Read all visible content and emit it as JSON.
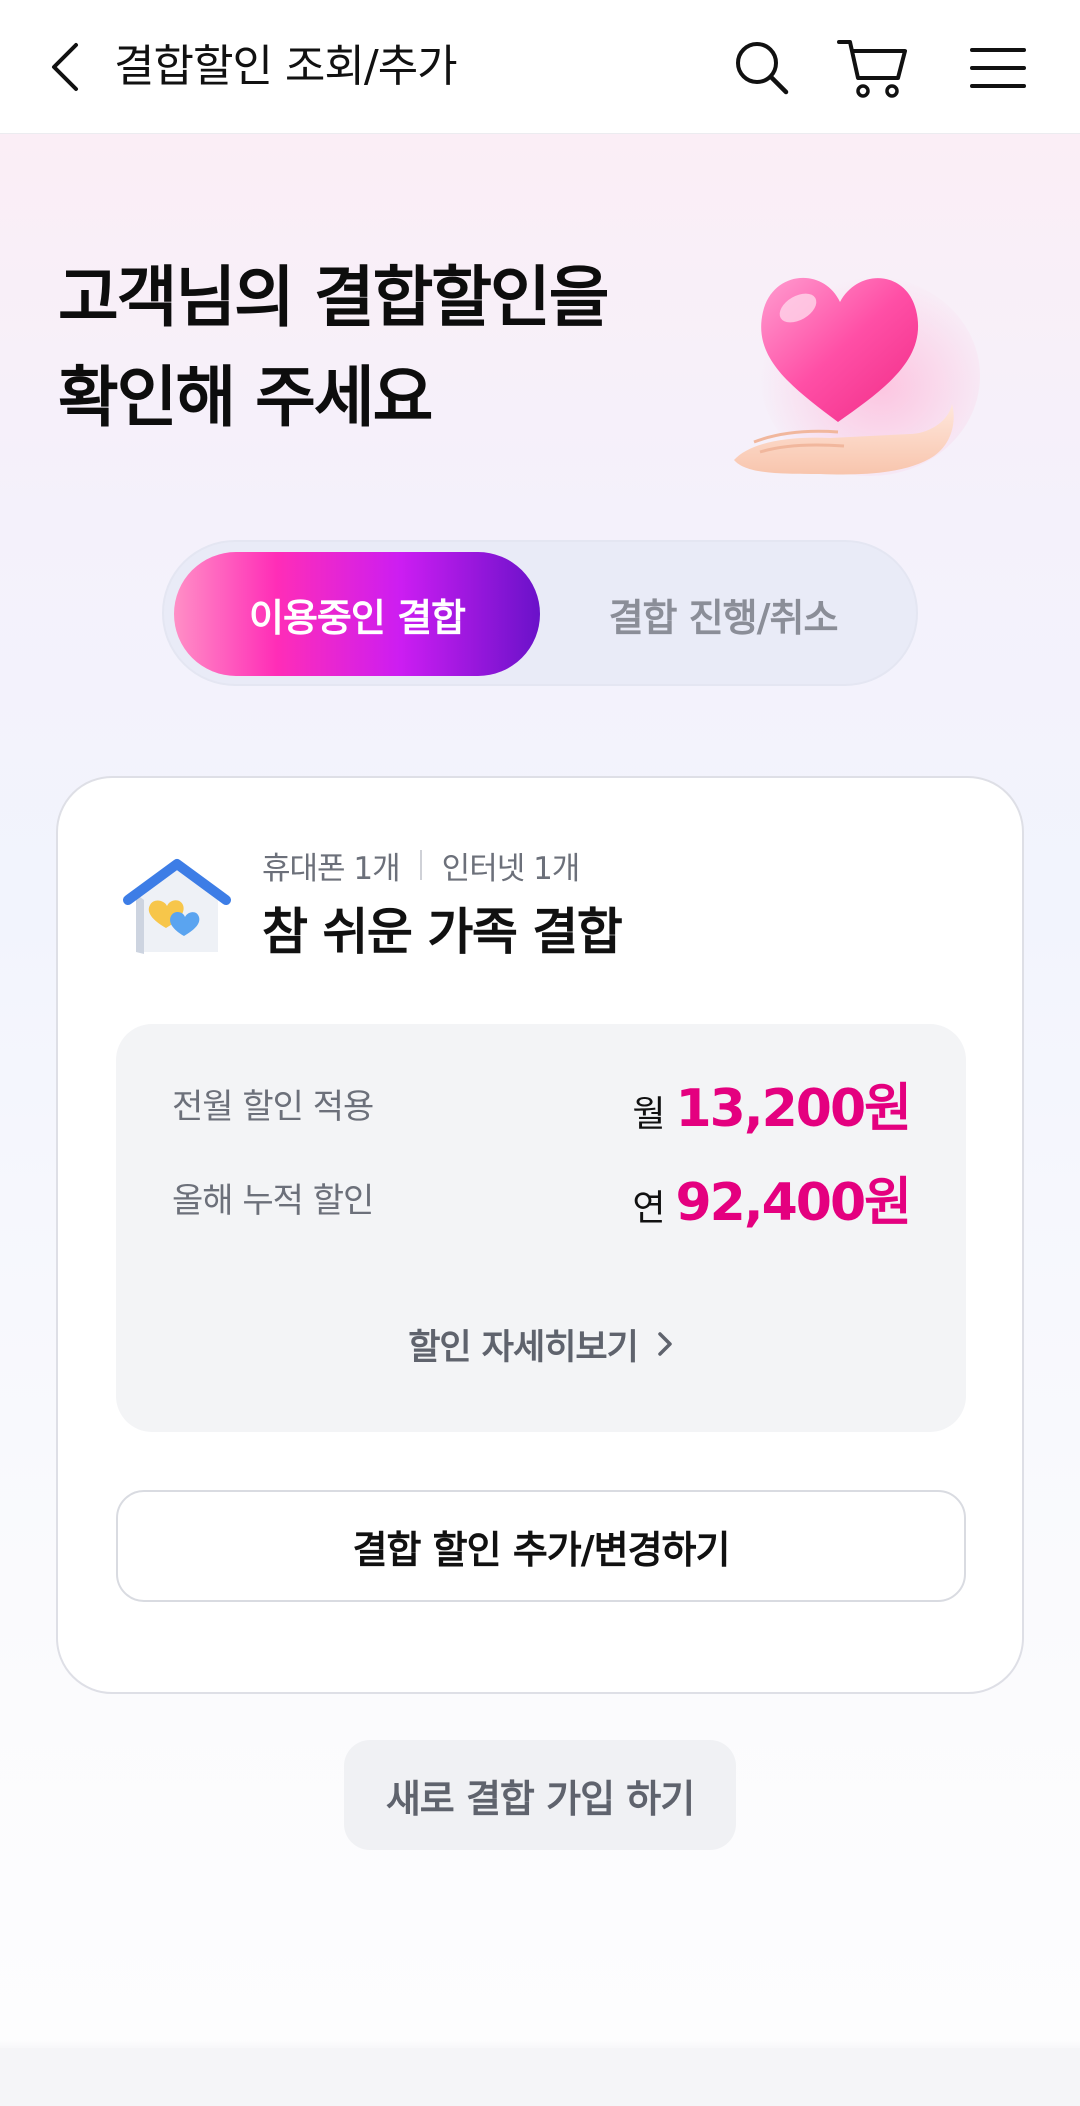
{
  "header": {
    "title": "결합할인 조회/추가",
    "back_icon": "chevron-left-icon",
    "search_icon": "search-icon",
    "cart_icon": "cart-icon",
    "menu_icon": "hamburger-menu-icon"
  },
  "hero": {
    "title_line1": "고객님의 결합할인을",
    "title_line2": "확인해 주세요",
    "illustration": "heart-on-hand-icon"
  },
  "tabs": [
    {
      "label": "이용중인 결합",
      "active": true
    },
    {
      "label": "결합 진행/취소",
      "active": false
    }
  ],
  "bundle": {
    "icon": "house-hearts-icon",
    "tags": [
      "휴대폰 1개",
      "인터넷 1개"
    ],
    "name": "참 쉬운 가족 결합",
    "rows": [
      {
        "label": "전월 할인 적용",
        "prefix": "월",
        "amount": "13,200원"
      },
      {
        "label": "올해 누적 할인",
        "prefix": "연",
        "amount": "92,400원"
      }
    ],
    "detail_link": "할인 자세히보기",
    "change_button": "결합 할인 추가/변경하기"
  },
  "new_join_button": "새로 결합 가입 하기",
  "colors": {
    "accent": "#e4007f",
    "tab_gradient_start": "#ff8fc6",
    "tab_gradient_end": "#6a12c9"
  }
}
